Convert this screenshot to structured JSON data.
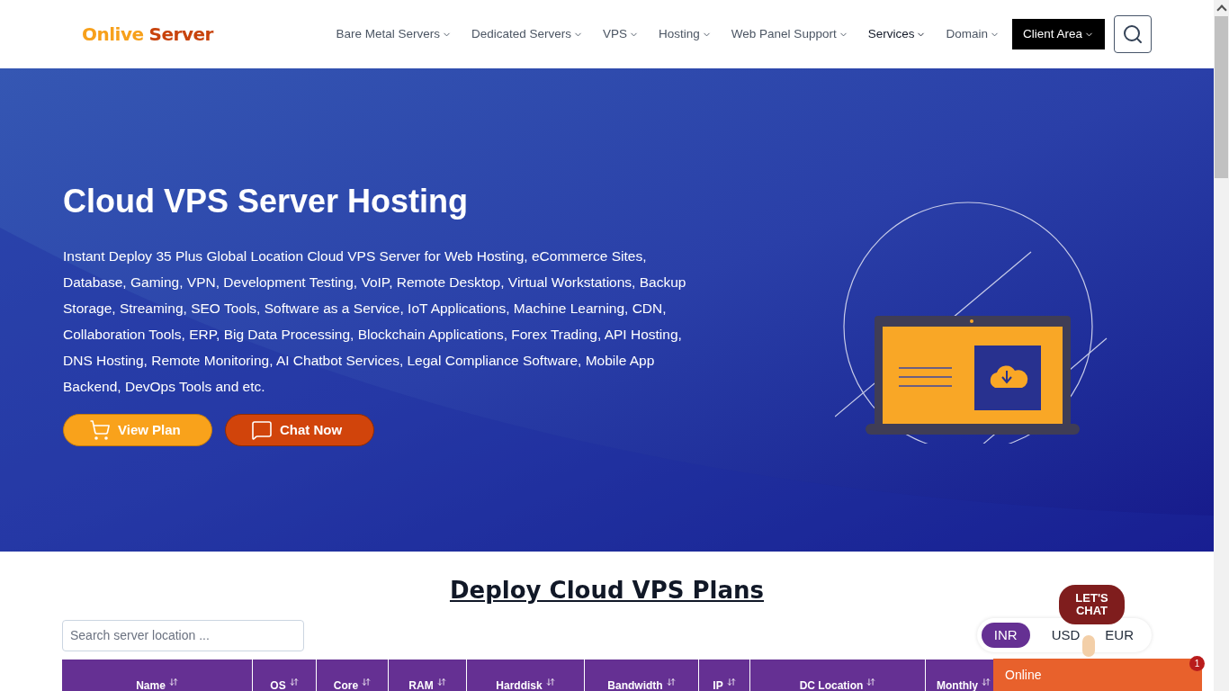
{
  "header": {
    "logo": {
      "first": "Onlive",
      "second": "Server"
    },
    "nav": [
      {
        "label": "Bare Metal Servers",
        "selected": false
      },
      {
        "label": "Dedicated Servers",
        "selected": false
      },
      {
        "label": "VPS",
        "selected": false
      },
      {
        "label": "Hosting",
        "selected": false
      },
      {
        "label": "Web Panel Support",
        "selected": false
      },
      {
        "label": "Services",
        "selected": true
      },
      {
        "label": "Domain",
        "selected": false
      }
    ],
    "client_area": "Client Area"
  },
  "hero": {
    "title": "Cloud VPS Server Hosting",
    "description": "Instant Deploy 35 Plus Global Location Cloud VPS Server for Web Hosting, eCommerce Sites, Database, Gaming, VPN, Development Testing, VoIP, Remote Desktop, Virtual Workstations, Backup Storage, Streaming, SEO Tools, Software as a Service, IoT Applications, Machine Learning, CDN, Collaboration Tools, ERP, Big Data Processing, Blockchain Applications, Forex Trading, API Hosting, DNS Hosting, Remote Monitoring, AI Chatbot Services, Legal Compliance Software, Mobile App Backend, DevOps Tools and etc.",
    "buttons": [
      {
        "label": "View Plan",
        "kind": "cart"
      },
      {
        "label": "Chat Now",
        "kind": "chat"
      }
    ]
  },
  "plans": {
    "title": "Deploy Cloud VPS Plans",
    "search": {
      "placeholder": "Search server location ..."
    },
    "currencies": [
      {
        "label": "INR",
        "selected": true
      },
      {
        "label": "USD",
        "selected": false
      },
      {
        "label": "EUR",
        "selected": false
      }
    ],
    "columns": [
      "Name",
      "OS",
      "Core",
      "RAM",
      "Harddisk",
      "Bandwidth",
      "IP",
      "DC Location",
      "Monthly"
    ]
  },
  "chat_widget": {
    "sticker_line_1": "LET'S",
    "sticker_line_2": "CHAT",
    "status": "Online",
    "unread": "1"
  }
}
